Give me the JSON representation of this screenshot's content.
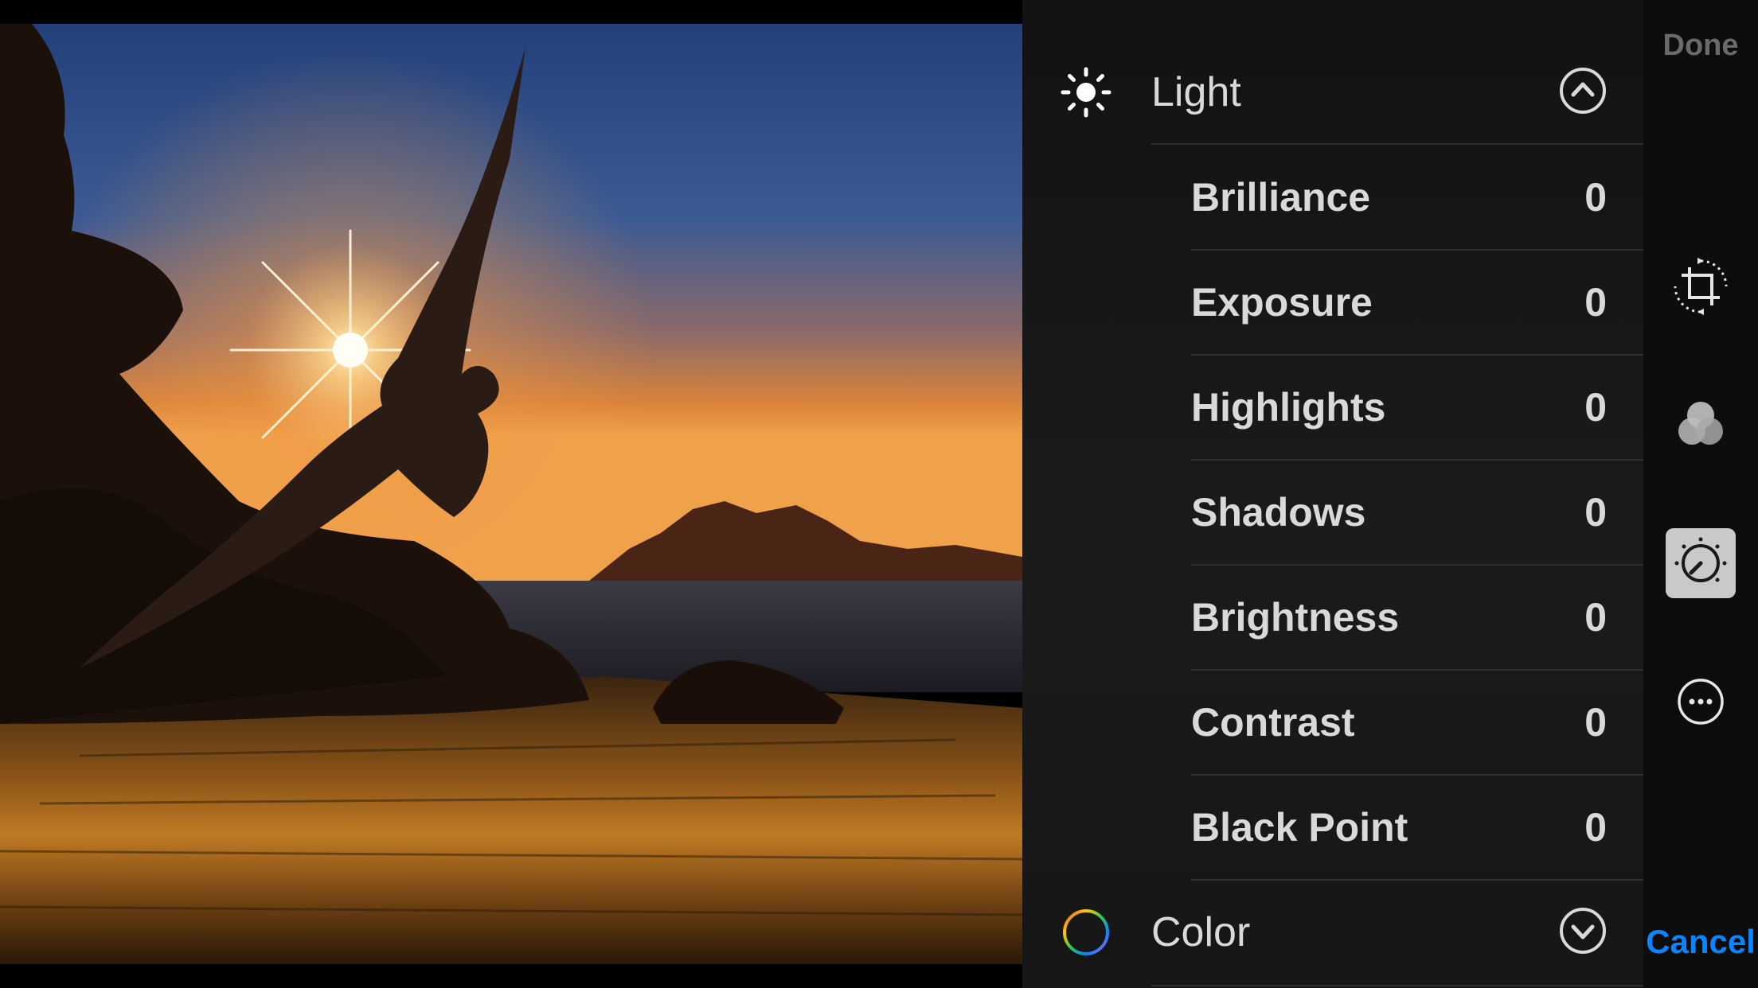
{
  "photo": {
    "description_alt": ""
  },
  "sections": {
    "light": {
      "title": "Light",
      "icon": "sun-icon",
      "expanded": true,
      "chevron_icon": "chevron-up-circle-icon",
      "items": [
        {
          "label": "Brilliance",
          "value": "0"
        },
        {
          "label": "Exposure",
          "value": "0"
        },
        {
          "label": "Highlights",
          "value": "0"
        },
        {
          "label": "Shadows",
          "value": "0"
        },
        {
          "label": "Brightness",
          "value": "0"
        },
        {
          "label": "Contrast",
          "value": "0"
        },
        {
          "label": "Black Point",
          "value": "0"
        }
      ]
    },
    "color": {
      "title": "Color",
      "icon": "color-wheel-icon",
      "expanded": false,
      "chevron_icon": "chevron-down-circle-icon"
    }
  },
  "toolbar": {
    "done_label": "Done",
    "cancel_label": "Cancel",
    "tools": [
      "crop-rotate-icon",
      "filters-icon",
      "adjust-dial-icon",
      "more-options-icon"
    ],
    "selected_tool": "adjust-dial-icon",
    "accent_color": "#0a84ff",
    "done_color": "#6a6a6a"
  }
}
